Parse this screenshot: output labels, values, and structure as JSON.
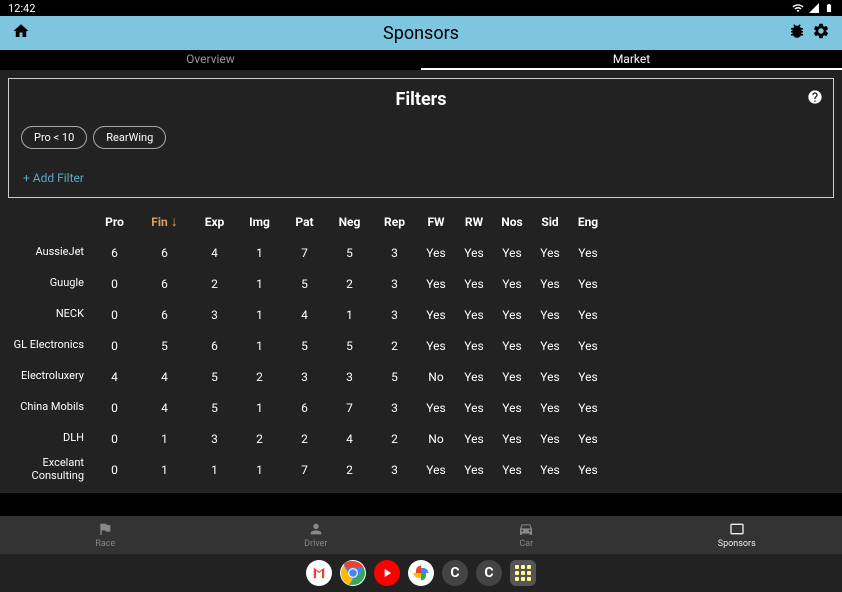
{
  "status": {
    "time": "12:42"
  },
  "app_bar": {
    "title": "Sponsors"
  },
  "tabs": {
    "overview": "Overview",
    "market": "Market"
  },
  "filters": {
    "title": "Filters",
    "chip1": "Pro < 10",
    "chip2": "RearWing",
    "add": "+ Add Filter"
  },
  "headers": [
    "Pro",
    "Fin",
    "Exp",
    "Img",
    "Pat",
    "Neg",
    "Rep",
    "FW",
    "RW",
    "Nos",
    "Sid",
    "Eng"
  ],
  "rows": [
    {
      "name": "AussieJet",
      "v": [
        "6",
        "6",
        "4",
        "1",
        "7",
        "5",
        "3",
        "Yes",
        "Yes",
        "Yes",
        "Yes",
        "Yes"
      ]
    },
    {
      "name": "Guugle",
      "v": [
        "0",
        "6",
        "2",
        "1",
        "5",
        "2",
        "3",
        "Yes",
        "Yes",
        "Yes",
        "Yes",
        "Yes"
      ]
    },
    {
      "name": "NECK",
      "v": [
        "0",
        "6",
        "3",
        "1",
        "4",
        "1",
        "3",
        "Yes",
        "Yes",
        "Yes",
        "Yes",
        "Yes"
      ]
    },
    {
      "name": "GL Electronics",
      "v": [
        "0",
        "5",
        "6",
        "1",
        "5",
        "5",
        "2",
        "Yes",
        "Yes",
        "Yes",
        "Yes",
        "Yes"
      ]
    },
    {
      "name": "Electroluxery",
      "v": [
        "4",
        "4",
        "5",
        "2",
        "3",
        "3",
        "5",
        "No",
        "Yes",
        "Yes",
        "Yes",
        "Yes"
      ]
    },
    {
      "name": "China Mobils",
      "v": [
        "0",
        "4",
        "5",
        "1",
        "6",
        "7",
        "3",
        "Yes",
        "Yes",
        "Yes",
        "Yes",
        "Yes"
      ]
    },
    {
      "name": "DLH",
      "v": [
        "0",
        "1",
        "3",
        "2",
        "2",
        "4",
        "2",
        "No",
        "Yes",
        "Yes",
        "Yes",
        "Yes"
      ]
    },
    {
      "name": "Excelant Consulting",
      "v": [
        "0",
        "1",
        "1",
        "1",
        "7",
        "2",
        "3",
        "Yes",
        "Yes",
        "Yes",
        "Yes",
        "Yes"
      ]
    }
  ],
  "nav": {
    "race": "Race",
    "driver": "Driver",
    "car": "Car",
    "sponsors": "Sponsors"
  }
}
